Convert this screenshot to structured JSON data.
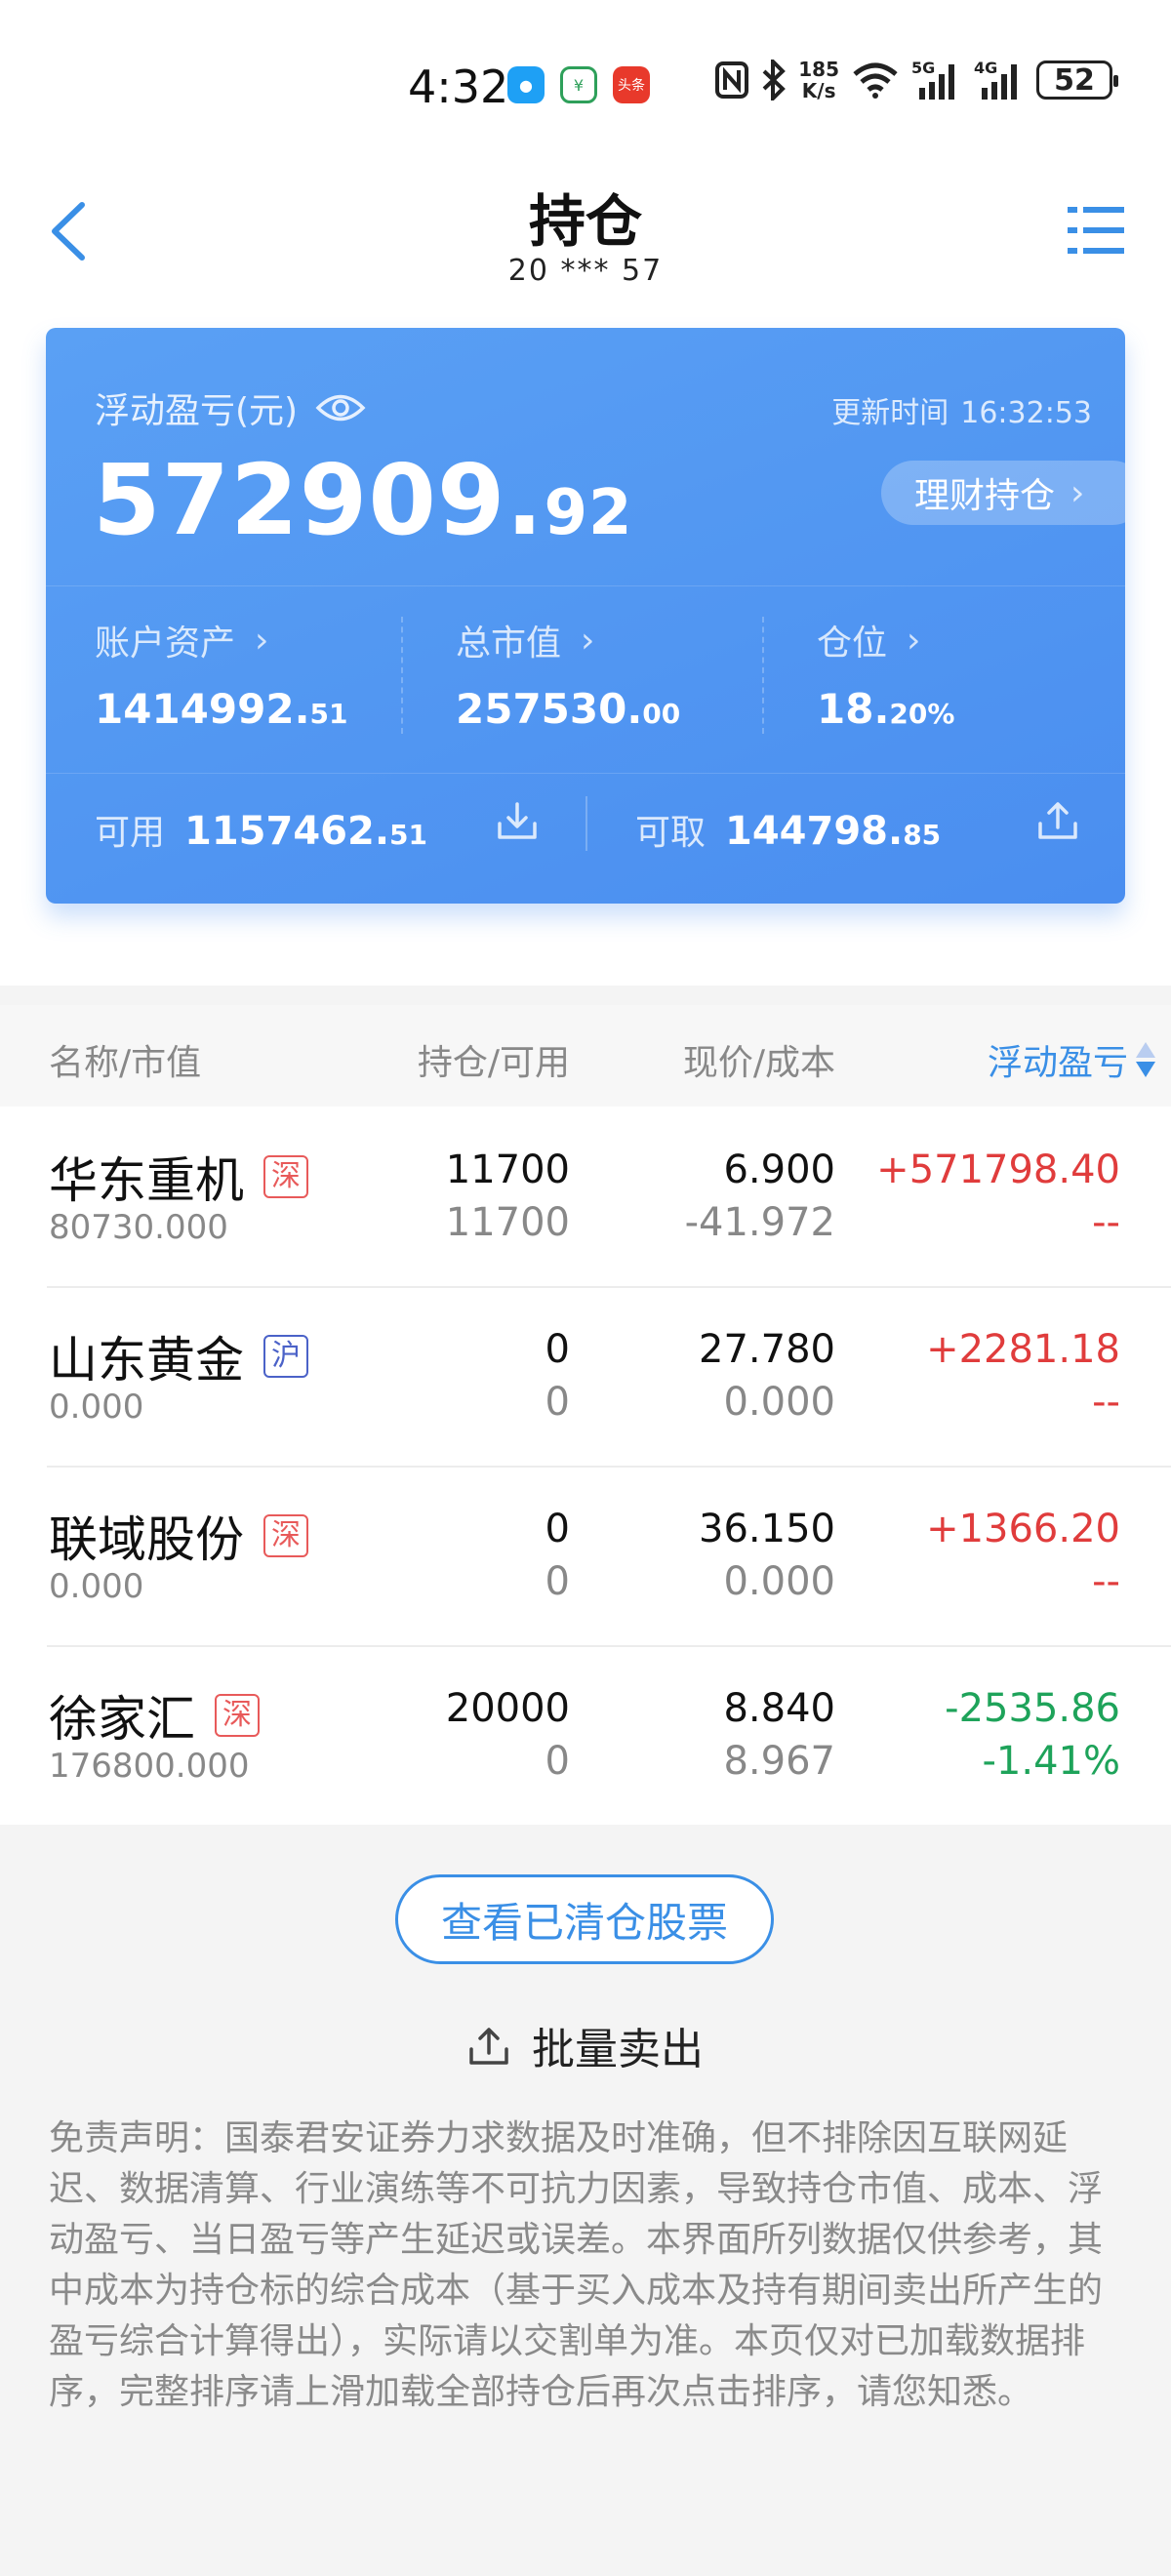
{
  "status_bar": {
    "time": "4:32",
    "net_speed": "185",
    "net_speed_unit": "K/s",
    "signal_1": "5G",
    "signal_2": "4G",
    "battery": "52"
  },
  "header": {
    "title": "持仓",
    "account": "20 *** 57"
  },
  "summary": {
    "pl_label": "浮动盈亏(元)",
    "update_label": "更新时间",
    "update_time": "16:32:53",
    "pl_int": "572909.",
    "pl_dec": "92",
    "licai_label": "理财持仓",
    "assets_label": "账户资产",
    "assets_int": "1414992.",
    "assets_dec": "51",
    "mv_label": "总市值",
    "mv_int": "257530.",
    "mv_dec": "00",
    "position_label": "仓位",
    "position_int": "18.",
    "position_dec": "20%",
    "avail_label": "可用",
    "avail_int": "1157462.",
    "avail_dec": "51",
    "withdraw_label": "可取",
    "withdraw_int": "144798.",
    "withdraw_dec": "85"
  },
  "table": {
    "headers": [
      "名称/市值",
      "持仓/可用",
      "现价/成本",
      "浮动盈亏"
    ],
    "rows": [
      {
        "name": "华东重机",
        "market": "深",
        "market_value": "80730.000",
        "holding": "11700",
        "available": "11700",
        "price": "6.900",
        "cost": "-41.972",
        "pl": "+571798.40",
        "pl_pct": "--",
        "trend": "up"
      },
      {
        "name": "山东黄金",
        "market": "沪",
        "market_value": "0.000",
        "holding": "0",
        "available": "0",
        "price": "27.780",
        "cost": "0.000",
        "pl": "+2281.18",
        "pl_pct": "--",
        "trend": "up"
      },
      {
        "name": "联域股份",
        "market": "深",
        "market_value": "0.000",
        "holding": "0",
        "available": "0",
        "price": "36.150",
        "cost": "0.000",
        "pl": "+1366.20",
        "pl_pct": "--",
        "trend": "up"
      },
      {
        "name": "徐家汇",
        "market": "深",
        "market_value": "176800.000",
        "holding": "20000",
        "available": "0",
        "price": "8.840",
        "cost": "8.967",
        "pl": "-2535.86",
        "pl_pct": "-1.41%",
        "trend": "down"
      }
    ]
  },
  "actions": {
    "cleared_label": "查看已清仓股票",
    "batch_sell_label": "批量卖出"
  },
  "disclaimer": "免责声明：国泰君安证券力求数据及时准确，但不排除因互联网延迟、数据清算、行业演练等不可抗力因素，导致持仓市值、成本、浮动盈亏、当日盈亏等产生延迟或误差。本界面所列数据仅供参考，其中成本为持仓标的综合成本（基于买入成本及持有期间卖出所产生的盈亏综合计算得出），实际请以交割单为准。本页仅对已加载数据排序，完整排序请上滑加载全部持仓后再次点击排序，请您知悉。",
  "colors": {
    "accent": "#3a8fe6",
    "card": "#4a8ef0",
    "up": "#e03c3c",
    "down": "#1ea35a"
  }
}
